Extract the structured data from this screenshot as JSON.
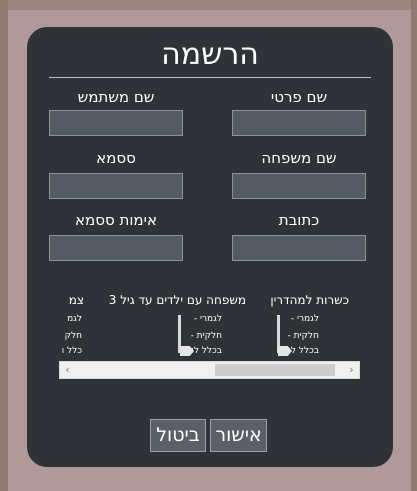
{
  "dialog": {
    "title": "הרשמה",
    "fields": {
      "first_name_label": "שם פרטי",
      "first_name_value": "",
      "username_label": "שם משתמש",
      "username_value": "",
      "last_name_label": "שם משפחה",
      "last_name_value": "",
      "password_label": "ססמא",
      "password_value": "",
      "address_label": "כתובת",
      "address_value": "",
      "password_confirm_label": "אימות ססמא",
      "password_confirm_value": ""
    },
    "preferences": [
      {
        "title": "כשרות למהדרין",
        "levels": [
          "לגמרי -",
          "חלקית -",
          "בכלל לא -"
        ],
        "selected": "בכלל לא -"
      },
      {
        "title": "משפחה עם ילדים עד גיל 3",
        "levels": [
          "לגמרי -",
          "חלקית -",
          "בכלל לא -"
        ],
        "selected": "בכלל לא -"
      },
      {
        "title": "צמ",
        "levels": [
          "לגמ",
          "חלק",
          "כלל ו"
        ],
        "selected": "כלל ו"
      }
    ],
    "scrollbar": {
      "left_arrow": "‹",
      "right_arrow": "›"
    },
    "buttons": {
      "confirm": "אישור",
      "cancel": "ביטול"
    }
  }
}
